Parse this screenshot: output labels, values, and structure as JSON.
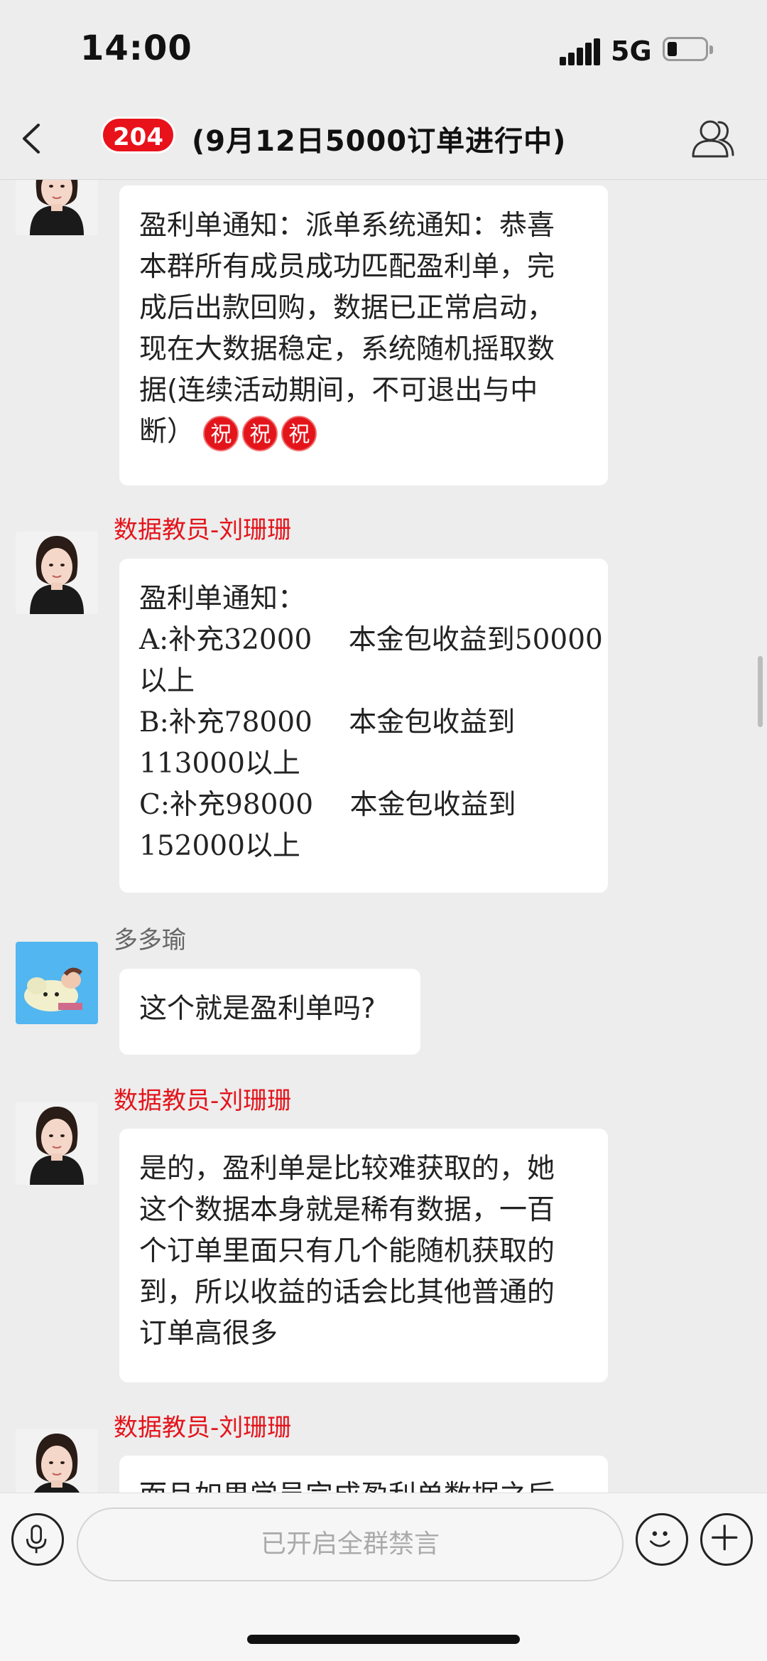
{
  "status_bar": {
    "time": "14:00",
    "network": "5G",
    "battery_level": 0.25
  },
  "header": {
    "unread_count": "204",
    "title": "(9月12日5000订单进行中)"
  },
  "messages": [
    {
      "sender": "",
      "avatar": "woman-portrait-avatar",
      "lines": [
        "盈利单通知：派单系统通知：恭喜",
        "本群所有成员成功匹配盈利单，完",
        "成后出款回购，数据已正常启动，",
        "现在大数据稳定，系统随机摇取数",
        "据(连续活动期间，不可退出与中",
        "断）"
      ],
      "emoji": [
        "祝",
        "祝",
        "祝"
      ]
    },
    {
      "sender": "数据教员-刘珊珊",
      "avatar": "woman-portrait-avatar",
      "lines": [
        "盈利单通知：",
        "A:补充32000　 本金包收益到50000",
        "以上",
        "B:补充78000　 本金包收益到",
        "113000以上",
        "C:补充98000　 本金包收益到",
        "152000以上"
      ]
    },
    {
      "sender": "多多瑜",
      "avatar": "plush-toy-avatar",
      "lines": [
        "这个就是盈利单吗?"
      ]
    },
    {
      "sender": "数据教员-刘珊珊",
      "avatar": "woman-portrait-avatar",
      "lines": [
        "是的，盈利单是比较难获取的，她",
        "这个数据本身就是稀有数据，一百",
        "个订单里面只有几个能随机获取的",
        "到，所以收益的话会比其他普通的",
        "订单高很多"
      ]
    },
    {
      "sender": "数据教员-刘珊珊",
      "avatar": "woman-portrait-avatar",
      "lines": [
        "而且如果学员完成盈利单数据之后"
      ]
    }
  ],
  "input_bar": {
    "placeholder": "已开启全群禁言"
  },
  "colors": {
    "accent_red": "#e4141b",
    "background": "#ededed",
    "bubble": "#ffffff"
  }
}
